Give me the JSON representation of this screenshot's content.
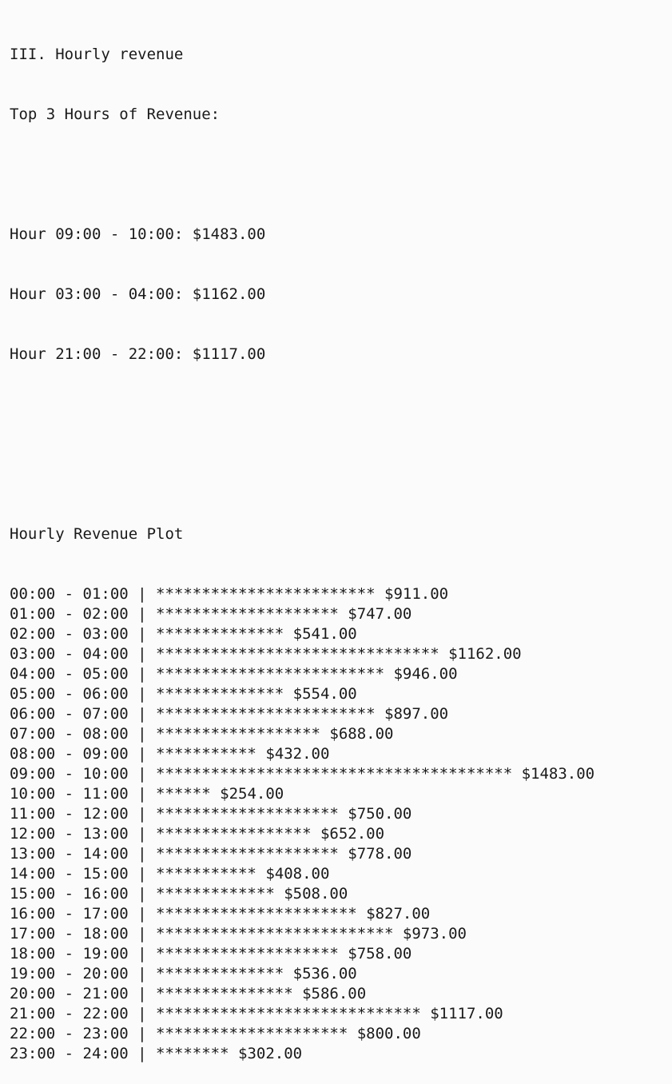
{
  "section_title": "III. Hourly revenue",
  "top_header": "Top 3 Hours of Revenue:",
  "top_hours": [
    "Hour 09:00 - 10:00: $1483.00",
    "Hour 03:00 - 04:00: $1162.00",
    "Hour 21:00 - 22:00: $1117.00"
  ],
  "plot_title": "Hourly Revenue Plot",
  "chart_data": {
    "type": "bar",
    "orientation": "horizontal",
    "title": "Hourly Revenue Plot",
    "bar_char": "*",
    "separator": "|",
    "categories": [
      "00:00 - 01:00",
      "01:00 - 02:00",
      "02:00 - 03:00",
      "03:00 - 04:00",
      "04:00 - 05:00",
      "05:00 - 06:00",
      "06:00 - 07:00",
      "07:00 - 08:00",
      "08:00 - 09:00",
      "09:00 - 10:00",
      "10:00 - 11:00",
      "11:00 - 12:00",
      "12:00 - 13:00",
      "13:00 - 14:00",
      "14:00 - 15:00",
      "15:00 - 16:00",
      "16:00 - 17:00",
      "17:00 - 18:00",
      "18:00 - 19:00",
      "19:00 - 20:00",
      "20:00 - 21:00",
      "21:00 - 22:00",
      "22:00 - 23:00",
      "23:00 - 24:00"
    ],
    "values": [
      911.0,
      747.0,
      541.0,
      1162.0,
      946.0,
      554.0,
      897.0,
      688.0,
      432.0,
      1483.0,
      254.0,
      750.0,
      652.0,
      778.0,
      408.0,
      508.0,
      827.0,
      973.0,
      758.0,
      536.0,
      586.0,
      1117.0,
      800.0,
      302.0
    ],
    "star_counts": [
      24,
      20,
      14,
      31,
      25,
      14,
      24,
      18,
      11,
      39,
      6,
      20,
      17,
      20,
      11,
      13,
      22,
      26,
      20,
      14,
      15,
      29,
      21,
      8
    ],
    "value_labels": [
      "$911.00",
      "$747.00",
      "$541.00",
      "$1162.00",
      "$946.00",
      "$554.00",
      "$897.00",
      "$688.00",
      "$432.00",
      "$1483.00",
      "$254.00",
      "$750.00",
      "$652.00",
      "$778.00",
      "$408.00",
      "$508.00",
      "$827.00",
      "$973.00",
      "$758.00",
      "$536.00",
      "$586.00",
      "$1117.00",
      "$800.00",
      "$302.00"
    ]
  }
}
